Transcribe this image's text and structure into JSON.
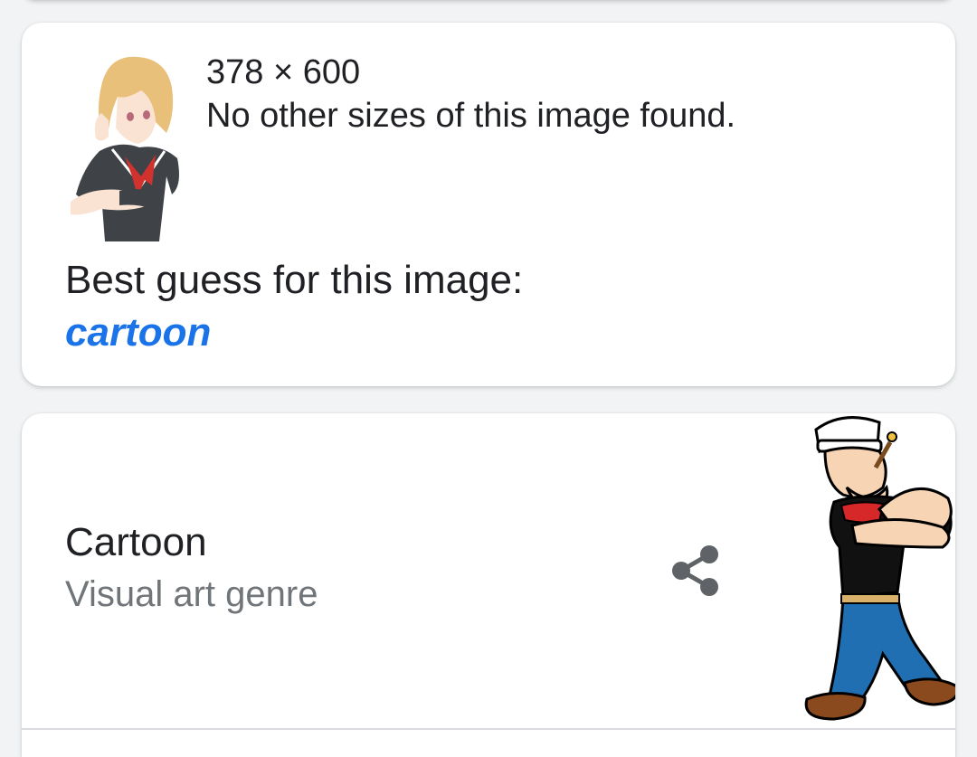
{
  "result_card": {
    "dimensions": "378 × 600",
    "other_sizes": "No other sizes of this image found.",
    "best_guess_label": "Best guess for this image:",
    "best_guess_value": "cartoon",
    "thumbnail_icon": "anime-girl-thumbnail"
  },
  "entity_card": {
    "title": "Cartoon",
    "subtitle": "Visual art genre",
    "share_icon": "share-icon",
    "image_icon": "popeye-cartoon-image"
  },
  "colors": {
    "link": "#1a73e8",
    "text_primary": "#202124",
    "text_secondary": "#70757a",
    "icon": "#5f6368",
    "background": "#f1f3f4"
  }
}
